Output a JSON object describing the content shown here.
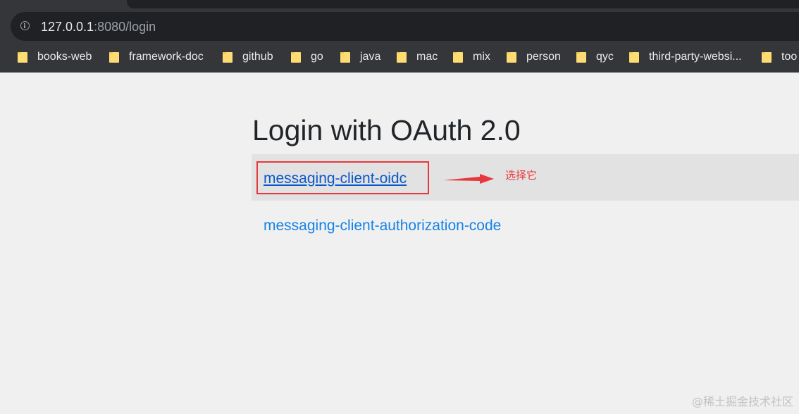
{
  "address_bar": {
    "host": "127.0.0.1",
    "rest": ":8080/login",
    "info_icon": "info-icon"
  },
  "bookmarks": [
    {
      "label": "books-web",
      "icon": "folder-icon"
    },
    {
      "label": "framework-doc",
      "icon": "folder-icon"
    },
    {
      "label": "github",
      "icon": "folder-icon"
    },
    {
      "label": "go",
      "icon": "folder-icon"
    },
    {
      "label": "java",
      "icon": "folder-icon"
    },
    {
      "label": "mac",
      "icon": "folder-icon"
    },
    {
      "label": "mix",
      "icon": "folder-icon"
    },
    {
      "label": "person",
      "icon": "folder-icon"
    },
    {
      "label": "qyc",
      "icon": "folder-icon"
    },
    {
      "label": "third-party-websi...",
      "icon": "folder-icon"
    },
    {
      "label": "too",
      "icon": "folder-icon"
    }
  ],
  "page": {
    "heading": "Login with OAuth 2.0",
    "links": [
      {
        "label": "messaging-client-oidc"
      },
      {
        "label": "messaging-client-authorization-code"
      }
    ]
  },
  "annotation": {
    "note": "选择它",
    "color": "#e8383d"
  },
  "watermark": "@稀土掘金技术社区"
}
